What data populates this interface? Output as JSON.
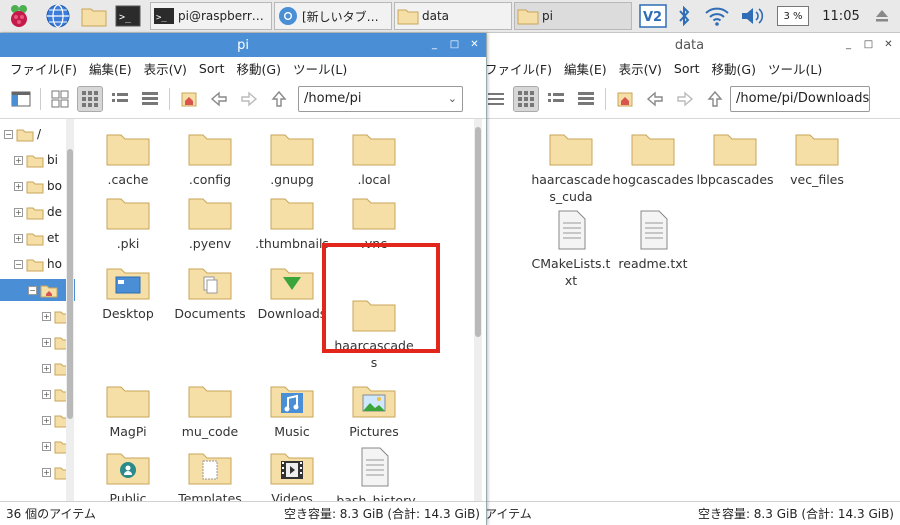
{
  "taskbar": {
    "tasks": [
      {
        "label": "",
        "icon": "terminal-icon"
      },
      {
        "label": "pi@raspberr…",
        "icon": "terminal-icon"
      },
      {
        "label": "[新しいタブ…",
        "icon": "chromium-icon"
      },
      {
        "label": "data",
        "icon": "folder-icon"
      },
      {
        "label": "pi",
        "icon": "folder-icon"
      }
    ],
    "cpu": "3 %",
    "clock": "11:05"
  },
  "window_pi": {
    "title": "pi",
    "path": "/home/pi",
    "status_left": "36 個のアイテム",
    "status_right": "空き容量: 8.3 GiB (合計: 14.3 GiB)",
    "tree": [
      "/",
      "bi",
      "bo",
      "de",
      "et",
      "ho",
      ""
    ],
    "items": [
      {
        "label": ".cache",
        "icon": "folder-icon"
      },
      {
        "label": ".config",
        "icon": "folder-icon"
      },
      {
        "label": ".gnupg",
        "icon": "folder-icon"
      },
      {
        "label": ".local",
        "icon": "folder-icon"
      },
      {
        "label": ".pki",
        "icon": "folder-icon"
      },
      {
        "label": ".pyenv",
        "icon": "folder-icon"
      },
      {
        "label": ".thumbnails",
        "icon": "folder-icon"
      },
      {
        "label": ".vnc",
        "icon": "folder-icon"
      },
      {
        "label": "Desktop",
        "icon": "desktop-folder-icon"
      },
      {
        "label": "Documents",
        "icon": "documents-folder-icon"
      },
      {
        "label": "Downloads",
        "icon": "downloads-folder-icon"
      },
      {
        "label": "haarcascades",
        "icon": "folder-icon"
      },
      {
        "label": "MagPi",
        "icon": "folder-icon"
      },
      {
        "label": "mu_code",
        "icon": "folder-icon"
      },
      {
        "label": "Music",
        "icon": "music-folder-icon"
      },
      {
        "label": "Pictures",
        "icon": "pictures-folder-icon"
      },
      {
        "label": "Public",
        "icon": "public-folder-icon"
      },
      {
        "label": "Templates",
        "icon": "templates-folder-icon"
      },
      {
        "label": "Videos",
        "icon": "videos-folder-icon"
      },
      {
        "label": ".bash_history",
        "icon": "text-file-icon"
      }
    ]
  },
  "window_data": {
    "title": "data",
    "path": "/home/pi/Downloads",
    "status_left": "アイテム",
    "status_right": "空き容量: 8.3 GiB (合計: 14.3 GiB)",
    "items": [
      {
        "label": "haarcascades_cuda",
        "icon": "folder-icon"
      },
      {
        "label": "hogcascades",
        "icon": "folder-icon"
      },
      {
        "label": "lbpcascades",
        "icon": "folder-icon"
      },
      {
        "label": "vec_files",
        "icon": "folder-icon"
      },
      {
        "label": "CMakeLists.txt",
        "icon": "text-file-icon"
      },
      {
        "label": "readme.txt",
        "icon": "text-file-icon"
      }
    ]
  },
  "menu": {
    "file": "ファイル(F)",
    "edit": "編集(E)",
    "view": "表示(V)",
    "sort": "Sort",
    "go": "移動(G)",
    "tools": "ツール(L)"
  },
  "colors": {
    "titlebar_active": "#4a8fd6",
    "folder_fill": "#f5dfa6",
    "folder_stroke": "#c9a55a",
    "highlight": "#e2261c"
  }
}
